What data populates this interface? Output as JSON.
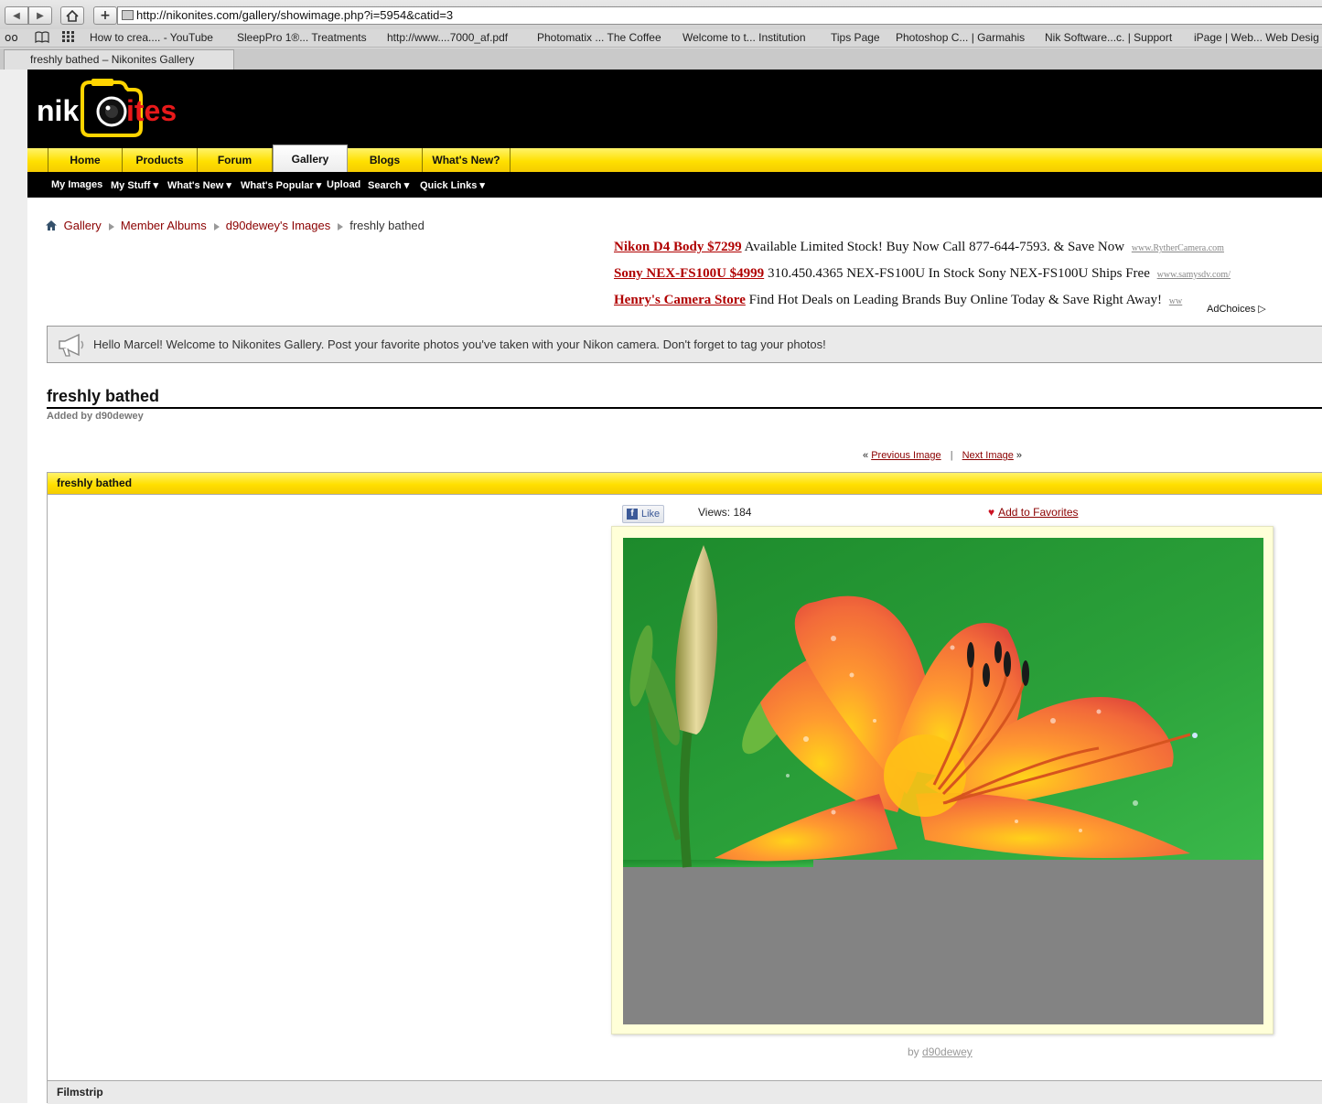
{
  "browser": {
    "url": "http://nikonites.com/gallery/showimage.php?i=5954&catid=3",
    "tab_title": "freshly bathed – Nikonites Gallery",
    "bookmarks": [
      "How to crea.... - YouTube",
      "SleepPro 1®... Treatments",
      "http://www....7000_af.pdf",
      "Photomatix ... The Coffee",
      "Welcome to t... Institution",
      "Tips Page",
      "Photoshop C... | Garmahis",
      "Nik Software...c. | Support",
      "iPage | Web... Web Desig"
    ]
  },
  "site": {
    "logo_text_1": "nik",
    "logo_text_2": "n",
    "logo_text_3": "ites",
    "main_tabs": [
      "Home",
      "Products",
      "Forum",
      "Gallery",
      "Blogs",
      "What's New?"
    ],
    "active_tab": "Gallery",
    "sub_nav": [
      "My Images",
      "My Stuff",
      "What's New",
      "What's Popular",
      "Upload",
      "Search",
      "Quick Links"
    ]
  },
  "breadcrumb": [
    "Gallery",
    "Member Albums",
    "d90dewey's Images",
    "freshly bathed"
  ],
  "ads": [
    {
      "title": "Nikon D4 Body $7299",
      "text": "Available Limited Stock! Buy Now Call 877-644-7593. & Save Now",
      "url": "www.RytherCamera.com"
    },
    {
      "title": "Sony NEX-FS100U $4999",
      "text": "310.450.4365 NEX-FS100U In Stock Sony NEX-FS100U Ships Free",
      "url": "www.samysdv.com/"
    },
    {
      "title": "Henry's Camera Store",
      "text": "Find Hot Deals on Leading Brands Buy Online Today & Save Right Away!",
      "url": "ww"
    }
  ],
  "adchoices": "AdChoices",
  "notice": "Hello Marcel! Welcome to Nikonites Gallery. Post your favorite photos you've taken with your Nikon camera. Don't forget to tag your photos!",
  "image": {
    "title": "freshly bathed",
    "added_by": "Added by d90dewey",
    "prev": "Previous Image",
    "next": "Next Image",
    "panel_title": "freshly bathed",
    "like": "Like",
    "views": "Views: 184",
    "add_fav": "Add to Favorites",
    "by_label": "by",
    "author": "d90dewey"
  },
  "filmstrip": "Filmstrip",
  "colors": {
    "accent_yellow": "#ffe000",
    "link_red": "#8b0000",
    "logo_red": "#e8191a"
  }
}
